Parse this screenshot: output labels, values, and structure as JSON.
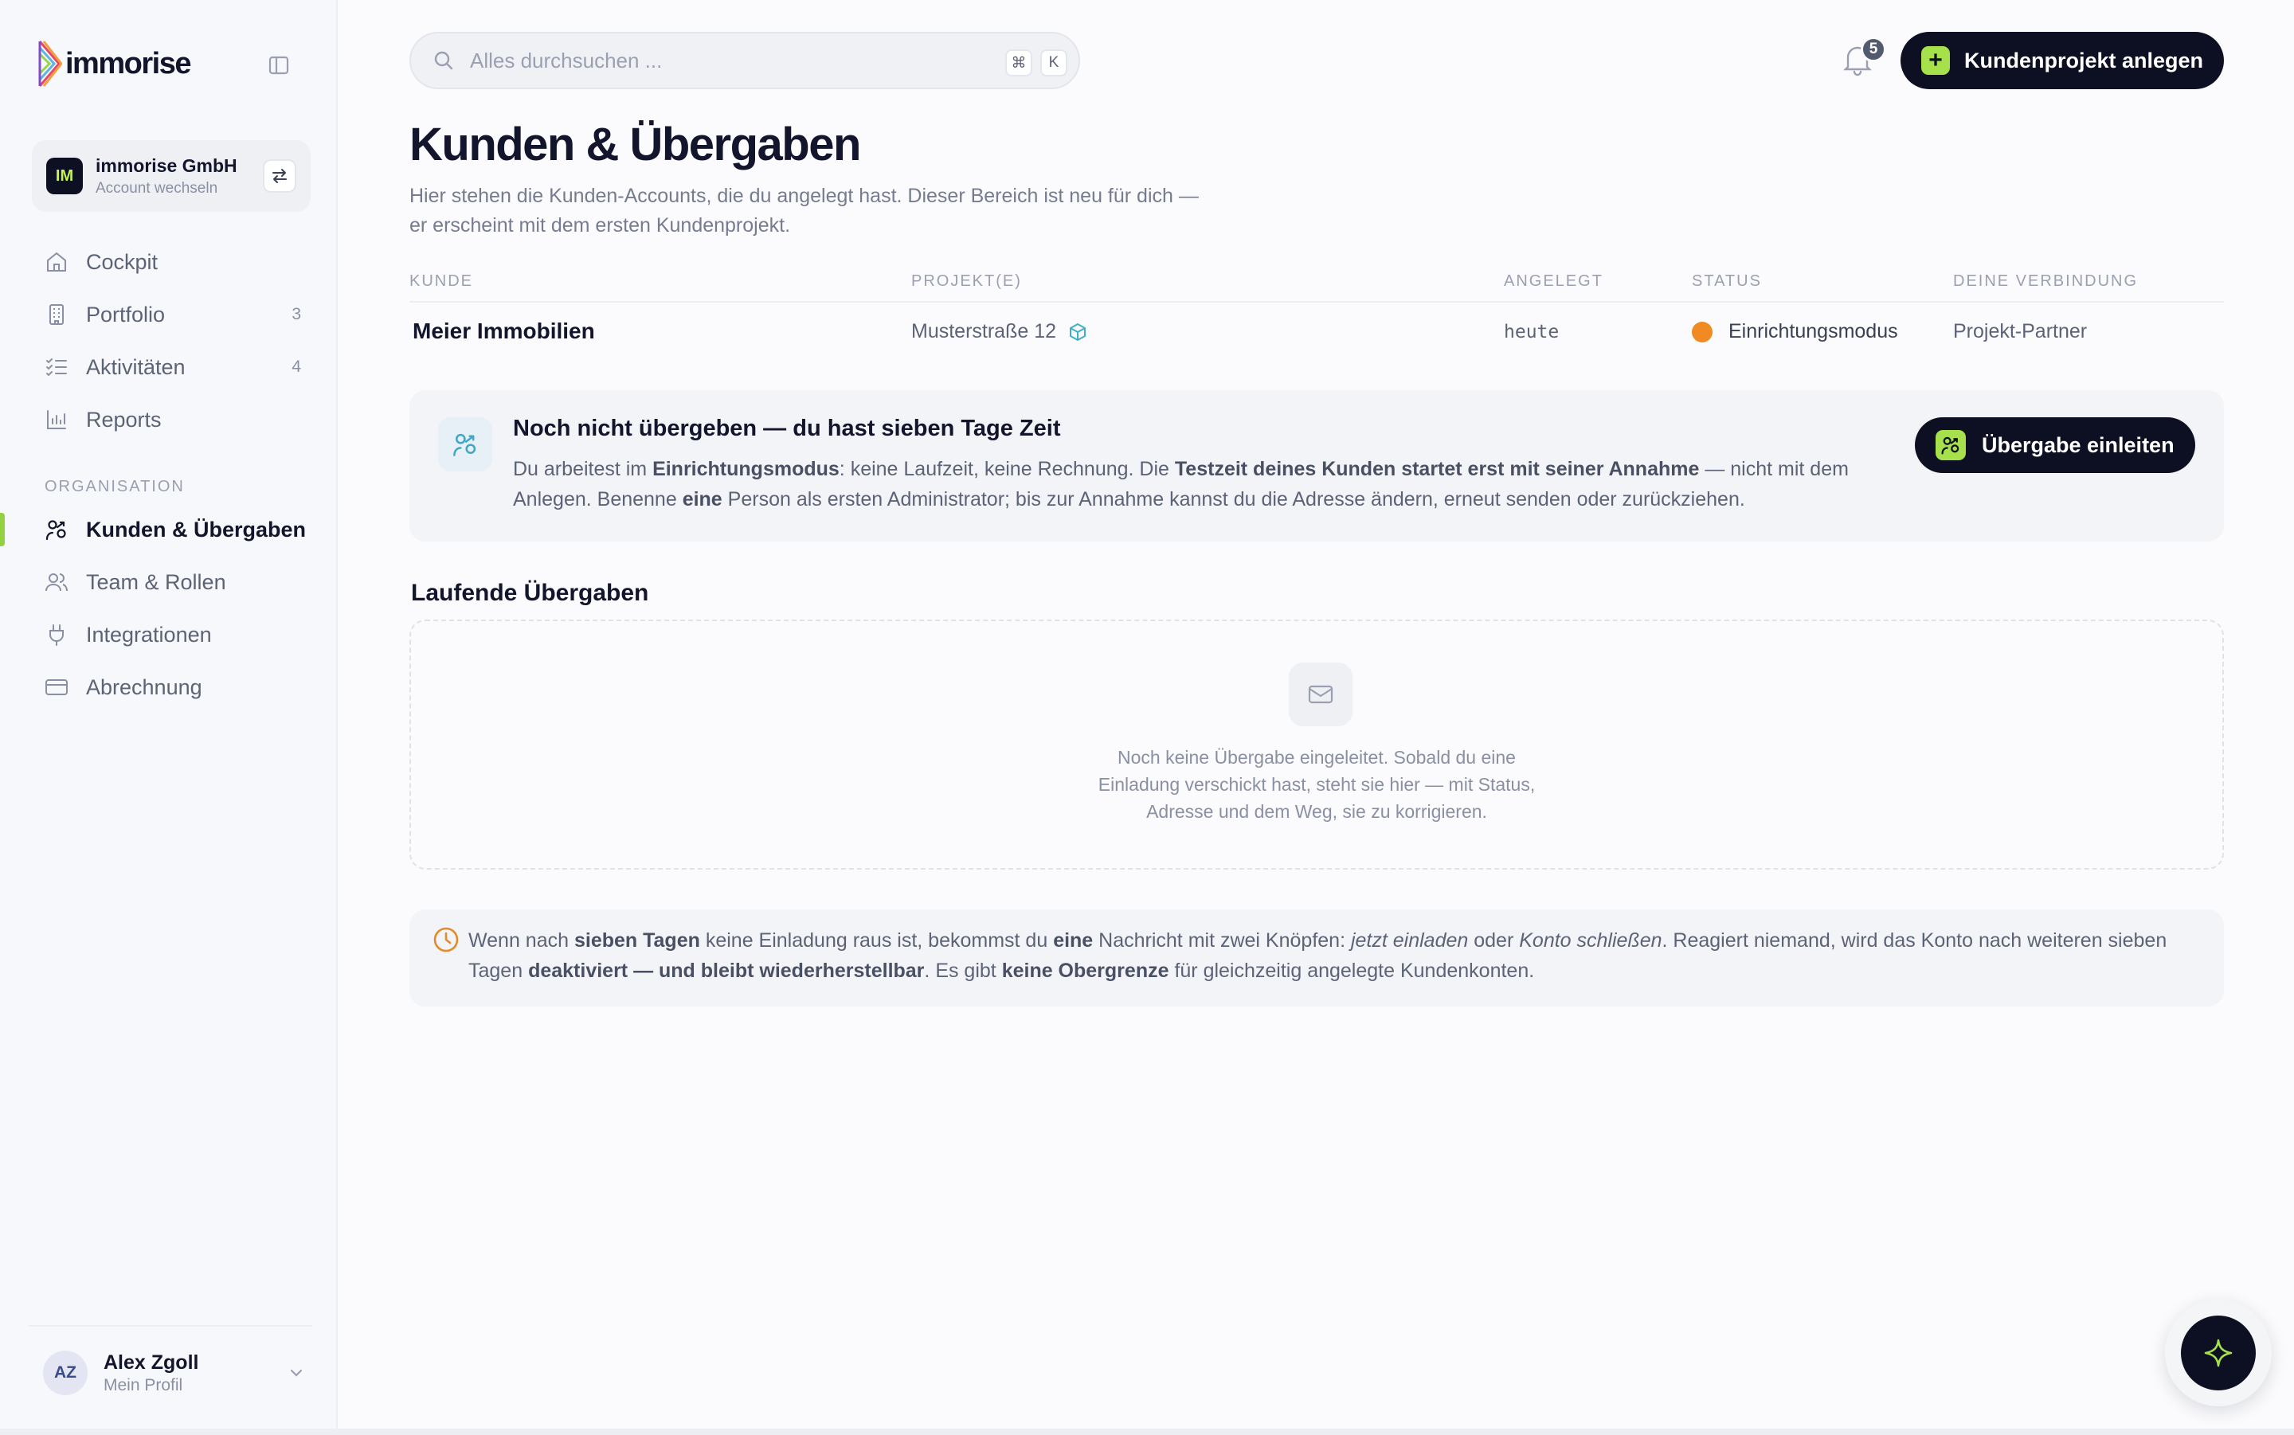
{
  "brand": {
    "logo_text": "immorise",
    "accent": "#a6e04a",
    "dark": "#0c1022"
  },
  "account": {
    "initials": "IM",
    "name": "immorise GmbH",
    "sub": "Account wechseln"
  },
  "nav": {
    "items": [
      {
        "label": "Cockpit",
        "icon": "home-icon",
        "count": ""
      },
      {
        "label": "Portfolio",
        "icon": "building-icon",
        "count": "3"
      },
      {
        "label": "Aktivitäten",
        "icon": "checklist-icon",
        "count": "4"
      },
      {
        "label": "Reports",
        "icon": "bar-chart-icon",
        "count": ""
      }
    ],
    "section_label": "ORGANISATION",
    "org_items": [
      {
        "label": "Kunden & Übergaben",
        "icon": "handshake-icon",
        "active": true
      },
      {
        "label": "Team & Rollen",
        "icon": "users-icon"
      },
      {
        "label": "Integrationen",
        "icon": "plug-icon"
      },
      {
        "label": "Abrechnung",
        "icon": "credit-card-icon"
      }
    ]
  },
  "profile": {
    "initials": "AZ",
    "name": "Alex Zgoll",
    "sub": "Mein Profil"
  },
  "search": {
    "placeholder": "Alles durchsuchen ...",
    "kbd_1": "⌘",
    "kbd_2": "K"
  },
  "notifications": {
    "count": "5"
  },
  "header": {
    "primary_button": "Kundenprojekt anlegen"
  },
  "page": {
    "title": "Kunden & Übergaben",
    "description": "Hier stehen die Kunden-Accounts, die du angelegt hast. Dieser Bereich ist neu für dich — er erscheint mit dem ersten Kundenprojekt."
  },
  "table": {
    "columns": [
      "KUNDE",
      "PROJEKT(E)",
      "ANGELEGT",
      "STATUS",
      "DEINE VERBINDUNG"
    ],
    "rows": [
      {
        "kunde": "Meier Immobilien",
        "projekt": "Musterstraße 12",
        "angelegt": "heute",
        "status": "Einrichtungsmodus",
        "status_color": "#f08b24",
        "verbindung": "Projekt-Partner"
      }
    ]
  },
  "callout": {
    "title": "Noch nicht übergeben — du hast sieben Tage Zeit",
    "text_1": "Du arbeitest im ",
    "text_b1": "Einrichtungsmodus",
    "text_2": ": keine Laufzeit, keine Rechnung. Die ",
    "text_b2": "Testzeit deines Kunden startet erst mit seiner Annahme",
    "text_3": " — nicht mit dem Anlegen. Benenne ",
    "text_b3": "eine",
    "text_4": " Person als ersten Administrator; bis zur Annahme kannst du die Adresse ändern, erneut senden oder zurückziehen.",
    "button": "Übergabe einleiten"
  },
  "handovers": {
    "title": "Laufende Übergaben",
    "empty_line_1": "Noch keine Übergabe eingeleitet. Sobald du eine",
    "empty_line_2": "Einladung verschickt hast, steht sie hier — mit Status,",
    "empty_line_3": "Adresse und dem Weg, sie zu korrigieren."
  },
  "info": {
    "t1": "Wenn nach ",
    "b1": "sieben Tagen",
    "t2": " keine Einladung raus ist, bekommst du ",
    "b2": "eine",
    "t3": " Nachricht mit zwei Knöpfen: ",
    "i1": "jetzt einladen",
    "t4": " oder ",
    "i2": "Konto schließen",
    "t5": ". Reagiert niemand, wird das Konto nach weiteren sieben Tagen ",
    "b3": "deaktiviert — und bleibt wiederherstellbar",
    "t6": ". Es gibt ",
    "b4": "keine Obergrenze",
    "t7": " für gleichzeitig angelegte Kundenkonten."
  },
  "fab": {
    "icon": "sparkle-icon"
  }
}
